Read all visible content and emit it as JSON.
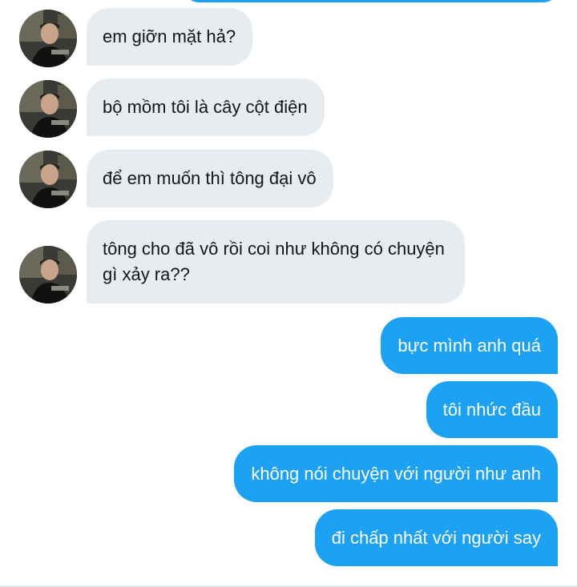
{
  "conversation": {
    "incoming": [
      {
        "text": "em giỡn mặt hả?",
        "avatar_icon": "profile-photo"
      },
      {
        "text": "bộ mồm tôi là cây cột điện",
        "avatar_icon": "profile-photo"
      },
      {
        "text": "để em muốn thì tông đại vô",
        "avatar_icon": "profile-photo"
      },
      {
        "text": "tông cho đã vô rồi coi như không có chuyện gì xảy ra??",
        "avatar_icon": "profile-photo"
      }
    ],
    "outgoing": [
      {
        "text": "bực mình anh quá"
      },
      {
        "text": "tôi nhức đầu"
      },
      {
        "text": "không nói chuyện với người như anh"
      },
      {
        "text": "đi chấp nhất với người say"
      }
    ]
  },
  "colors": {
    "outgoing_bubble": "#1da1f2",
    "incoming_bubble": "#e6ecf0",
    "incoming_text": "#14171a",
    "outgoing_text": "#ffffff"
  }
}
